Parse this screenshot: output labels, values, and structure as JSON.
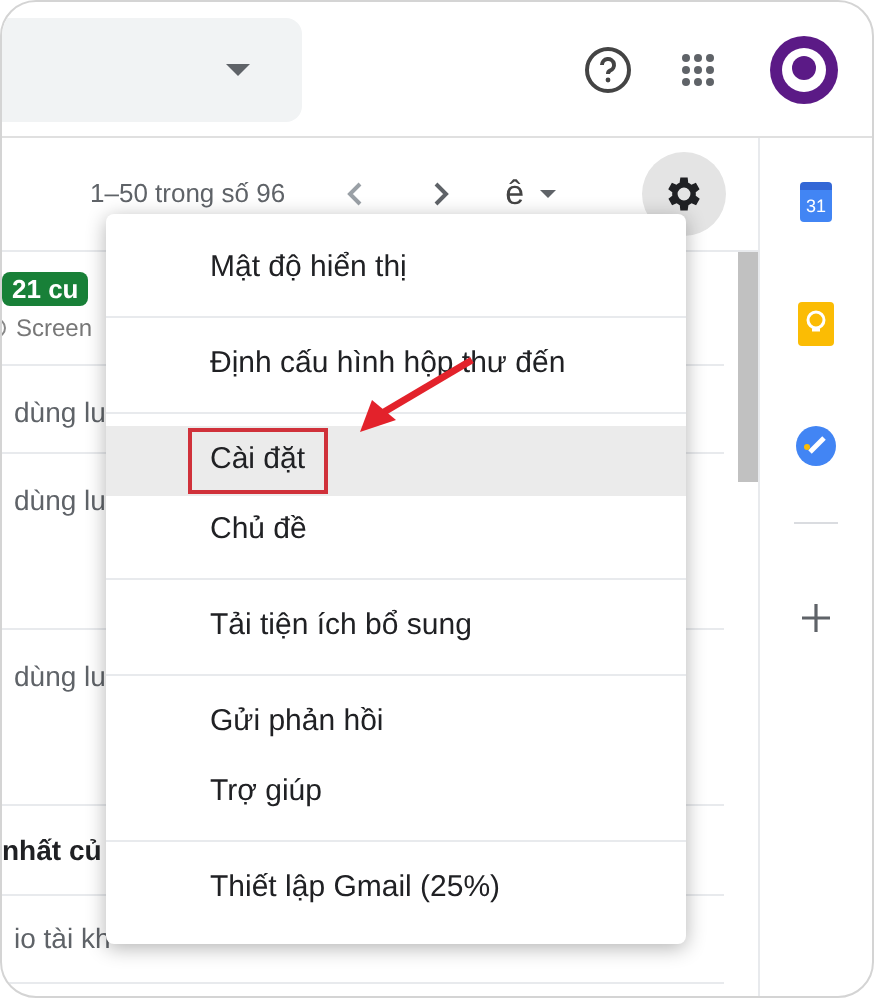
{
  "toolbar": {
    "pagination": "1–50 trong số 96",
    "input_tool": "ê"
  },
  "list": {
    "rows": [
      {
        "kind": "badge",
        "badge": "21 cu",
        "sub": "Screen"
      },
      {
        "kind": "plain",
        "text": "dùng lu"
      },
      {
        "kind": "plain",
        "text": "dùng lu"
      },
      {
        "kind": "plain",
        "text": "dùng lu"
      },
      {
        "kind": "bold",
        "text": "nhất củ"
      },
      {
        "kind": "plain",
        "text": "io tài kh"
      }
    ]
  },
  "menu": {
    "groups": [
      [
        {
          "label": "Mật độ hiển thị",
          "selected": false,
          "annotated": false
        }
      ],
      [
        {
          "label": "Định cấu hình hộp thư đến",
          "selected": false,
          "annotated": false
        }
      ],
      [
        {
          "label": "Cài đặt",
          "selected": true,
          "annotated": true
        },
        {
          "label": "Chủ đề",
          "selected": false,
          "annotated": false
        }
      ],
      [
        {
          "label": "Tải tiện ích bổ sung",
          "selected": false,
          "annotated": false
        }
      ],
      [
        {
          "label": "Gửi phản hồi",
          "selected": false,
          "annotated": false
        },
        {
          "label": "Trợ giúp",
          "selected": false,
          "annotated": false
        }
      ],
      [
        {
          "label": "Thiết lập Gmail (25%)",
          "selected": false,
          "annotated": false
        }
      ]
    ]
  },
  "side_panel": {
    "calendar_day": "31"
  }
}
